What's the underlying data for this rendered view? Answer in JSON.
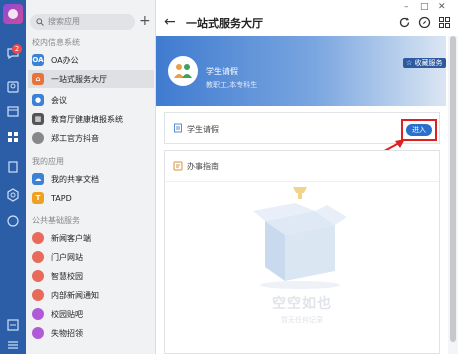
{
  "sidebar": {
    "search_placeholder": "搜索应用",
    "add_symbol": "+",
    "groups": [
      {
        "title": "校内信息系统",
        "items": [
          {
            "label": "OA办公",
            "color": "#3b82d6",
            "glyph": "OA"
          },
          {
            "label": "一站式服务大厅",
            "color": "#e8743b",
            "glyph": ""
          },
          {
            "label": "会议",
            "color": "#3b82d6",
            "glyph": ""
          },
          {
            "label": "教育厅健康填报系统",
            "color": "#555555",
            "glyph": ""
          },
          {
            "label": "郑工官方抖音",
            "color": "#888888",
            "glyph": ""
          }
        ]
      },
      {
        "title": "我的应用",
        "items": [
          {
            "label": "我的共享文档",
            "color": "#3b82d6",
            "glyph": ""
          },
          {
            "label": "TAPD",
            "color": "#f0a020",
            "glyph": "T"
          }
        ]
      },
      {
        "title": "公共基础服务",
        "items": [
          {
            "label": "新闻客户端",
            "color": "#e86a5a",
            "glyph": ""
          },
          {
            "label": "门户网站",
            "color": "#e86a5a",
            "glyph": ""
          },
          {
            "label": "智慧校园",
            "color": "#e86a5a",
            "glyph": ""
          },
          {
            "label": "内部新闻通知",
            "color": "#e86a5a",
            "glyph": ""
          },
          {
            "label": "校园贴吧",
            "color": "#b05ad8",
            "glyph": ""
          },
          {
            "label": "失物招领",
            "color": "#b05ad8",
            "glyph": ""
          }
        ]
      }
    ]
  },
  "rail": {
    "badge_count": "2"
  },
  "header": {
    "back_symbol": "←",
    "title": "一站式服务大厅",
    "window_minimize": "–",
    "window_maximize": "□",
    "window_close": "✕"
  },
  "banner": {
    "app_name": "学生请假",
    "app_sub": "教职工,本专科生",
    "favorite_label": "收藏服务"
  },
  "service_card": {
    "label": "学生请假",
    "enter_label": "进入"
  },
  "guide": {
    "label": "办事指南",
    "empty_title": "空空如也",
    "empty_sub": "暂无任何记录"
  },
  "colors": {
    "rail": "#2c5ea8",
    "accent": "#2b6fcc",
    "highlight": "#e02020",
    "banner_start": "#3f7bd0"
  }
}
